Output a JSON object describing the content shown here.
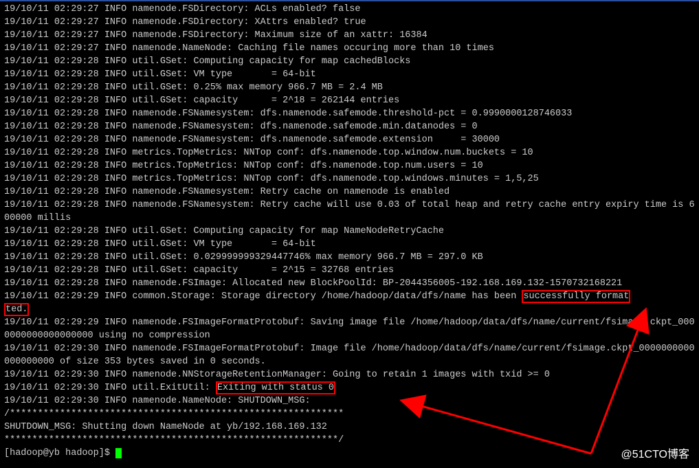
{
  "watermark": "@51CTO博客",
  "header_text": "successfully format",
  "header_text2": "ted.",
  "exit_text": "Exiting with status 0",
  "prompt": "[hadoop@yb hadoop]$ ",
  "lines": [
    "19/10/11 02:29:27 INFO namenode.FSDirectory: ACLs enabled? false",
    "19/10/11 02:29:27 INFO namenode.FSDirectory: XAttrs enabled? true",
    "19/10/11 02:29:27 INFO namenode.FSDirectory: Maximum size of an xattr: 16384",
    "19/10/11 02:29:27 INFO namenode.NameNode: Caching file names occuring more than 10 times",
    "19/10/11 02:29:28 INFO util.GSet: Computing capacity for map cachedBlocks",
    "19/10/11 02:29:28 INFO util.GSet: VM type       = 64-bit",
    "19/10/11 02:29:28 INFO util.GSet: 0.25% max memory 966.7 MB = 2.4 MB",
    "19/10/11 02:29:28 INFO util.GSet: capacity      = 2^18 = 262144 entries",
    "19/10/11 02:29:28 INFO namenode.FSNamesystem: dfs.namenode.safemode.threshold-pct = 0.9990000128746033",
    "19/10/11 02:29:28 INFO namenode.FSNamesystem: dfs.namenode.safemode.min.datanodes = 0",
    "19/10/11 02:29:28 INFO namenode.FSNamesystem: dfs.namenode.safemode.extension     = 30000",
    "19/10/11 02:29:28 INFO metrics.TopMetrics: NNTop conf: dfs.namenode.top.window.num.buckets = 10",
    "19/10/11 02:29:28 INFO metrics.TopMetrics: NNTop conf: dfs.namenode.top.num.users = 10",
    "19/10/11 02:29:28 INFO metrics.TopMetrics: NNTop conf: dfs.namenode.top.windows.minutes = 1,5,25",
    "19/10/11 02:29:28 INFO namenode.FSNamesystem: Retry cache on namenode is enabled",
    "19/10/11 02:29:28 INFO namenode.FSNamesystem: Retry cache will use 0.03 of total heap and retry cache entry expiry time is 600000 millis",
    "19/10/11 02:29:28 INFO util.GSet: Computing capacity for map NameNodeRetryCache",
    "19/10/11 02:29:28 INFO util.GSet: VM type       = 64-bit",
    "19/10/11 02:29:28 INFO util.GSet: 0.029999999329447746% max memory 966.7 MB = 297.0 KB",
    "19/10/11 02:29:28 INFO util.GSet: capacity      = 2^15 = 32768 entries",
    "19/10/11 02:29:28 INFO namenode.FSImage: Allocated new BlockPoolId: BP-2044356005-192.168.169.132-1570732168221",
    "19/10/11 02:29:29 INFO common.Storage: Storage directory /home/hadoop/data/dfs/name has been ",
    "",
    "19/10/11 02:29:29 INFO namenode.FSImageFormatProtobuf: Saving image file /home/hadoop/data/dfs/name/current/fsimage.ckpt_0000000000000000000 using no compression",
    "19/10/11 02:29:30 INFO namenode.FSImageFormatProtobuf: Image file /home/hadoop/data/dfs/name/current/fsimage.ckpt_0000000000000000000 of size 353 bytes saved in 0 seconds.",
    "19/10/11 02:29:30 INFO namenode.NNStorageRetentionManager: Going to retain 1 images with txid >= 0",
    "19/10/11 02:29:30 INFO util.ExitUtil: ",
    "19/10/11 02:29:30 INFO namenode.NameNode: SHUTDOWN_MSG:",
    "/************************************************************",
    "SHUTDOWN_MSG: Shutting down NameNode at yb/192.168.169.132",
    "************************************************************/"
  ]
}
